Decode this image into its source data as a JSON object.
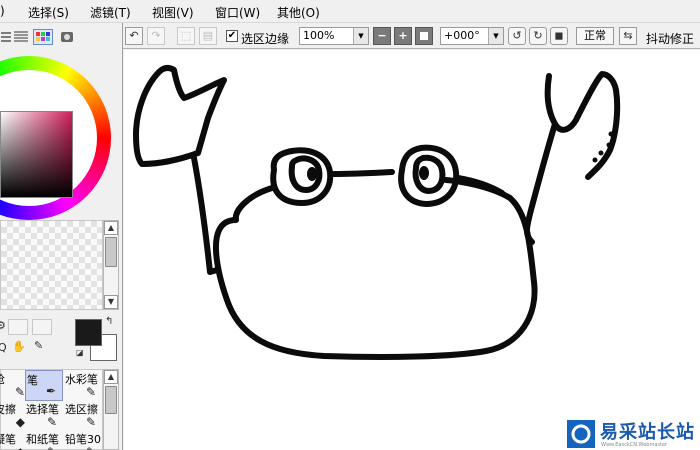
{
  "menu": [
    {
      "id": "edit",
      "label": ")"
    },
    {
      "id": "select",
      "label": "选择(S)"
    },
    {
      "id": "filter",
      "label": "滤镜(T)"
    },
    {
      "id": "view",
      "label": "视图(V)"
    },
    {
      "id": "window",
      "label": "窗口(W)"
    },
    {
      "id": "other",
      "label": "其他(O)"
    }
  ],
  "toolbar": {
    "selection_edge_label": "选区边缘",
    "selection_edge_checked": true,
    "checkmark": "✔",
    "zoom_value": "100%",
    "rotation_value": "+000°",
    "blend_mode_label": "正常",
    "stabilizer_label": "抖动修正",
    "minus": "−",
    "plus": "+"
  },
  "tools": [
    {
      "label": "枪",
      "icon": "airbrush-icon",
      "glyph": "✎"
    },
    {
      "label": "笔",
      "icon": "pen-icon",
      "glyph": "✒",
      "active": true
    },
    {
      "label": "水彩笔",
      "icon": "watercolor-icon",
      "glyph": "✎"
    },
    {
      "label": "皮擦",
      "icon": "eraser-icon",
      "glyph": "◆"
    },
    {
      "label": "选择笔",
      "icon": "select-pen-icon",
      "glyph": "✎"
    },
    {
      "label": "选区擦",
      "icon": "select-eraser-icon",
      "glyph": "✎"
    },
    {
      "label": "凝笔",
      "icon": "blur-icon",
      "glyph": "◆"
    },
    {
      "label": "和纸笔",
      "icon": "washi-icon",
      "glyph": "✎"
    },
    {
      "label": "铅笔30",
      "icon": "pencil-icon",
      "glyph": "✎"
    }
  ],
  "colors": {
    "foreground": "#1a1a1a",
    "background": "#ffffff",
    "watermark_blue": "#1565c0"
  },
  "watermark": {
    "text": "易采站长站",
    "url": "Www.EasckCN.Webmaster"
  }
}
